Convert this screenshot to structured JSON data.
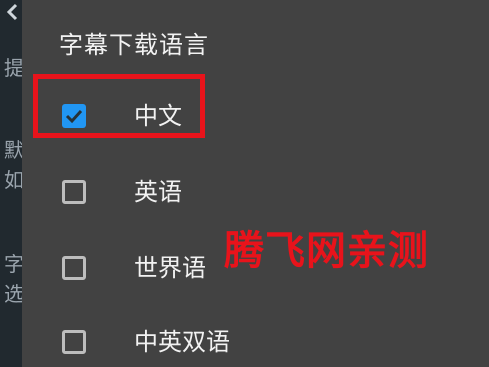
{
  "background": {
    "texts": [
      "提",
      "默",
      "如",
      "字",
      "选"
    ]
  },
  "dialog": {
    "title": "字幕下载语言",
    "options": [
      {
        "label": "中文",
        "checked": true
      },
      {
        "label": "英语",
        "checked": false
      },
      {
        "label": "世界语",
        "checked": false
      },
      {
        "label": "中英双语",
        "checked": false
      }
    ]
  },
  "watermark": {
    "text": "腾飞网亲测"
  },
  "colors": {
    "dialog_bg": "#424242",
    "accent": "#2196f3",
    "annotation_red": "#e8131b",
    "checkbox_border": "#bdbdbd"
  }
}
